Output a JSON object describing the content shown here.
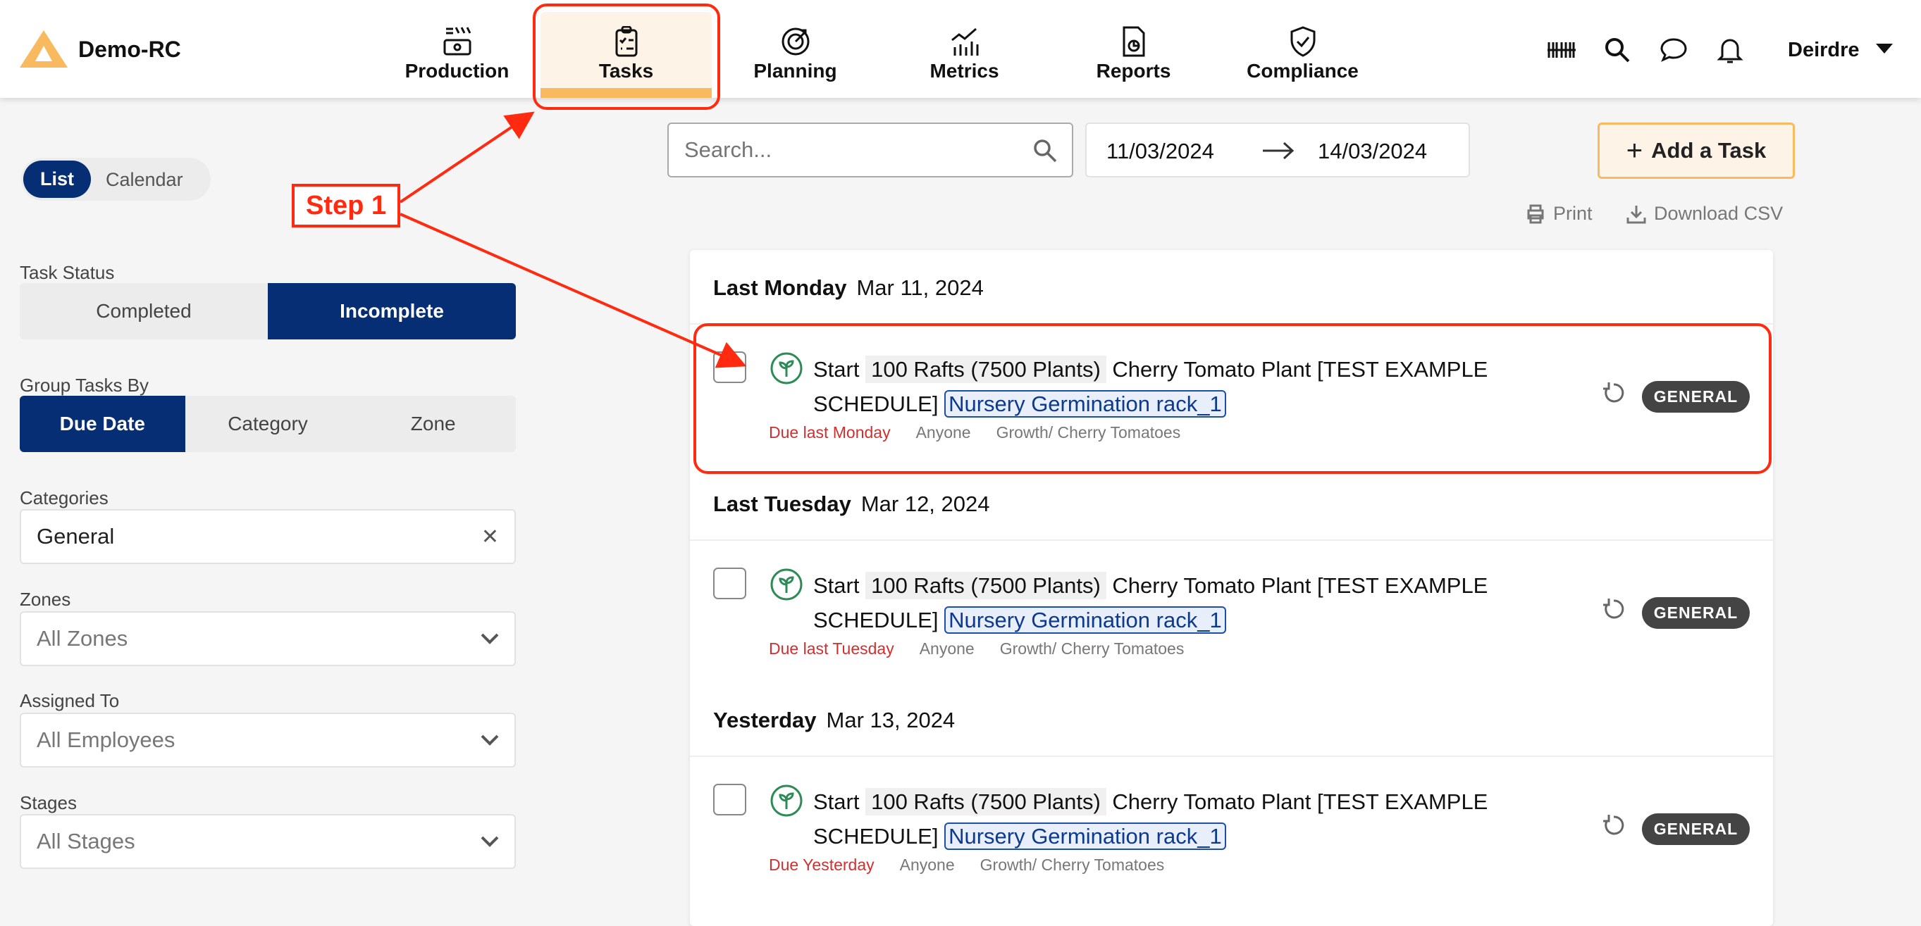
{
  "app": {
    "name": "Demo-RC",
    "accent": "#f9b95f",
    "primary": "#062e74"
  },
  "nav": [
    {
      "label": "Production",
      "icon": "production-icon"
    },
    {
      "label": "Tasks",
      "icon": "clipboard-icon",
      "active": true
    },
    {
      "label": "Planning",
      "icon": "target-icon"
    },
    {
      "label": "Metrics",
      "icon": "chart-icon"
    },
    {
      "label": "Reports",
      "icon": "report-icon"
    },
    {
      "label": "Compliance",
      "icon": "shield-check-icon"
    }
  ],
  "header_right": {
    "user": "Deirdre"
  },
  "view_toggle": {
    "list": "List",
    "calendar": "Calendar"
  },
  "filters": {
    "task_status": {
      "label": "Task Status",
      "options": [
        "Completed",
        "Incomplete"
      ],
      "selected": "Incomplete"
    },
    "group_by": {
      "label": "Group Tasks By",
      "options": [
        "Due Date",
        "Category",
        "Zone"
      ],
      "selected": "Due Date"
    },
    "categories": {
      "label": "Categories",
      "value": "General"
    },
    "zones": {
      "label": "Zones",
      "value": "All Zones"
    },
    "assigned": {
      "label": "Assigned To",
      "value": "All Employees"
    },
    "stages": {
      "label": "Stages",
      "value": "All Stages"
    }
  },
  "toolbar": {
    "search_placeholder": "Search...",
    "date_from": "11/03/2024",
    "date_to": "14/03/2024",
    "add_task": "Add a Task",
    "print": "Print",
    "download": "Download CSV"
  },
  "groups": [
    {
      "title": "Last Monday",
      "date": "Mar 11, 2024",
      "task": {
        "verb": "Start",
        "qty": "100 Rafts (7500 Plants)",
        "name": "Cherry Tomato Plant [TEST EXAMPLE SCHEDULE]",
        "zone": "Nursery Germination rack_1",
        "due": "Due last Monday",
        "assignee": "Anyone",
        "category": "Growth/ Cherry Tomatoes",
        "badge": "GENERAL"
      }
    },
    {
      "title": "Last Tuesday",
      "date": "Mar 12, 2024",
      "task": {
        "verb": "Start",
        "qty": "100 Rafts (7500 Plants)",
        "name": "Cherry Tomato Plant [TEST EXAMPLE SCHEDULE]",
        "zone": "Nursery Germination rack_1",
        "due": "Due last Tuesday",
        "assignee": "Anyone",
        "category": "Growth/ Cherry Tomatoes",
        "badge": "GENERAL"
      }
    },
    {
      "title": "Yesterday",
      "date": "Mar 13, 2024",
      "task": {
        "verb": "Start",
        "qty": "100 Rafts (7500 Plants)",
        "name": "Cherry Tomato Plant [TEST EXAMPLE SCHEDULE]",
        "zone": "Nursery Germination rack_1",
        "due": "Due Yesterday",
        "assignee": "Anyone",
        "category": "Growth/ Cherry Tomatoes",
        "badge": "GENERAL"
      }
    }
  ],
  "annotation": {
    "step": "Step 1",
    "color": "#ff2a10"
  }
}
